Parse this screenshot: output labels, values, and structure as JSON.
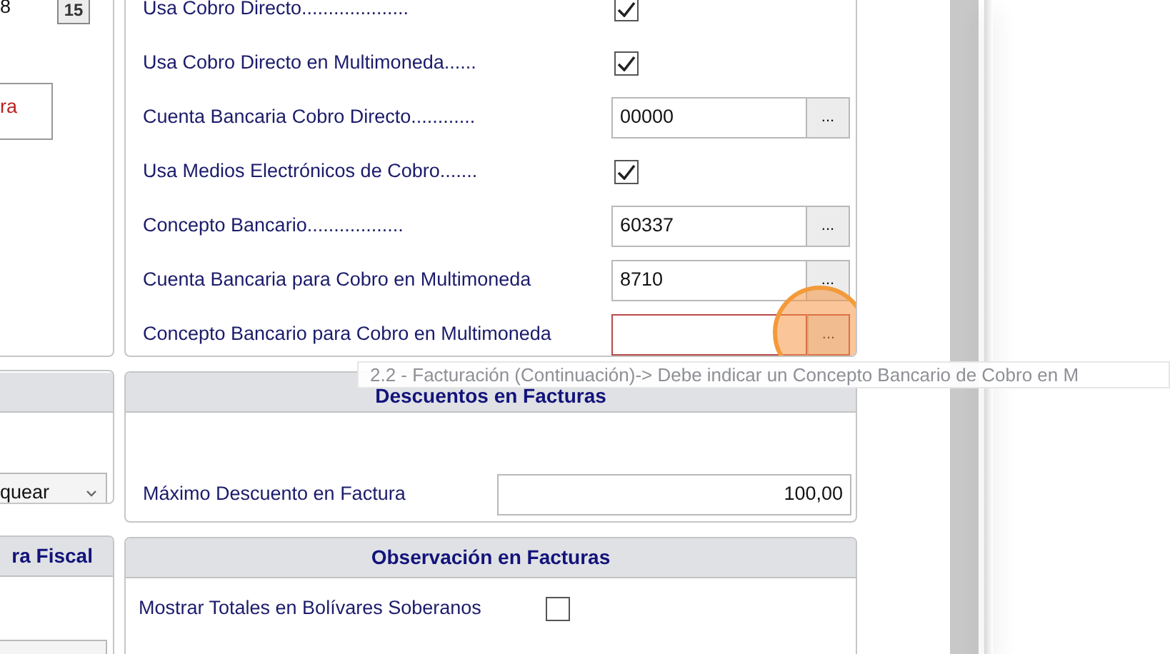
{
  "left_column": {
    "date_field": {
      "value": "8"
    },
    "calendar_button": {
      "label": "15"
    },
    "note_box": {
      "text": "ra"
    },
    "dropdown": {
      "value": "quear"
    },
    "fiscal_panel": {
      "title": "ra Fiscal"
    }
  },
  "facturacion_panel": {
    "rows": [
      {
        "kind": "checkbox",
        "label": "Usa Cobro Directo....................",
        "checked": true
      },
      {
        "kind": "checkbox",
        "label": "Usa Cobro Directo en Multimoneda......",
        "checked": true
      },
      {
        "kind": "lookup",
        "label": "Cuenta Bancaria Cobro Directo............",
        "value": "00000",
        "button": "...",
        "error": false
      },
      {
        "kind": "checkbox",
        "label": "Usa Medios Electrónicos de Cobro.......",
        "checked": true
      },
      {
        "kind": "lookup",
        "label": "Concepto Bancario..................",
        "value": "60337",
        "button": "...",
        "error": false
      },
      {
        "kind": "lookup",
        "label": "Cuenta Bancaria para Cobro en Multimoneda",
        "value": "8710",
        "button": "...",
        "error": false
      },
      {
        "kind": "lookup",
        "label": "Concepto Bancario para Cobro en Multimoneda",
        "button": "...",
        "error": true,
        "clicked": true
      }
    ]
  },
  "descuentos_panel": {
    "title": "Descuentos en Facturas",
    "label": "Máximo Descuento en Factura",
    "value": "100,00"
  },
  "observacion_panel": {
    "title": "Observación en Facturas",
    "rows": [
      {
        "kind": "checkbox",
        "label": "Mostrar Totales en Bolívares Soberanos",
        "checked": false
      }
    ]
  },
  "tooltip": {
    "text": "2.2 - Facturación (Continuación)-> Debe indicar un Concepto Bancario de Cobro en M"
  }
}
